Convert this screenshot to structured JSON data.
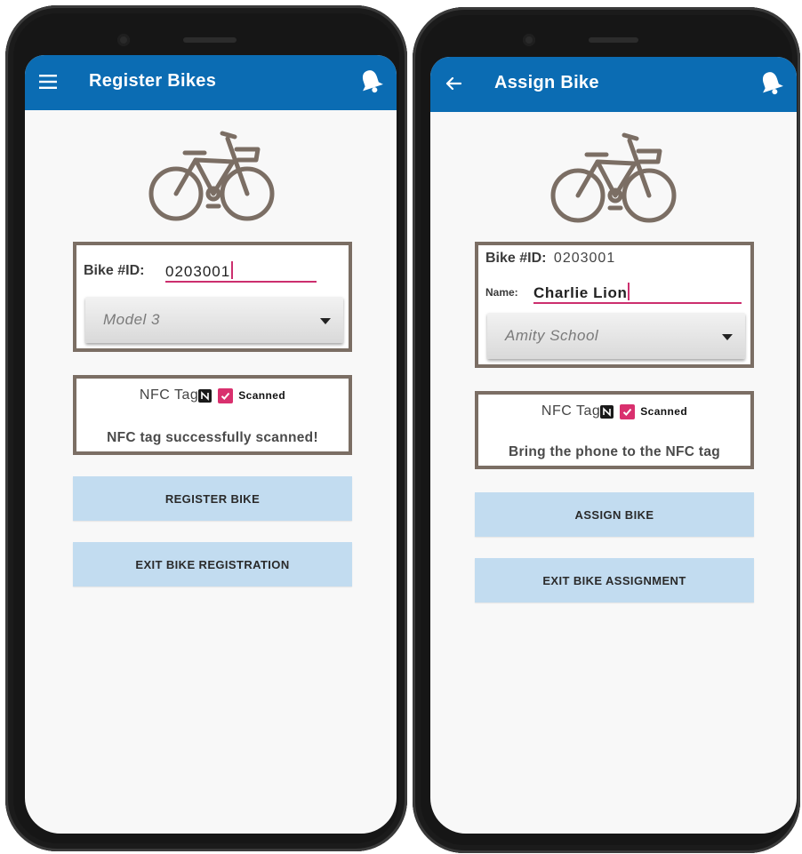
{
  "screens": [
    {
      "app_bar": {
        "nav_icon": "menu-icon",
        "title": "Register Bikes",
        "action_icon": "notification-bell-icon"
      },
      "bike_id": {
        "label": "Bike #ID:",
        "value": "0203001"
      },
      "model_dropdown": {
        "selected": "Model 3"
      },
      "nfc": {
        "label": "NFC Tag",
        "checkbox_label": "Scanned",
        "checked": true,
        "status": "NFC tag successfully scanned!"
      },
      "buttons": {
        "primary": "REGISTER BIKE",
        "exit": "EXIT BIKE REGISTRATION"
      }
    },
    {
      "app_bar": {
        "nav_icon": "back-arrow-icon",
        "title": "Assign Bike",
        "action_icon": "notification-bell-icon"
      },
      "bike_id": {
        "label": "Bike #ID:",
        "value": "0203001"
      },
      "name": {
        "label": "Name:",
        "value": "Charlie Lion"
      },
      "school_dropdown": {
        "selected": "Amity School"
      },
      "nfc": {
        "label": "NFC Tag",
        "checkbox_label": "Scanned",
        "checked": true,
        "status": "Bring the phone to the NFC tag"
      },
      "buttons": {
        "primary": "ASSIGN BIKE",
        "exit": "EXIT BIKE ASSIGNMENT"
      }
    }
  ],
  "colors": {
    "app_bar": "#0b6cb3",
    "accent_pink": "#cc2f6e",
    "box_border": "#7b6e64",
    "button_bg": "#c2dcf0",
    "screen_bg": "#f8f8f8",
    "phone_body": "#161616"
  }
}
